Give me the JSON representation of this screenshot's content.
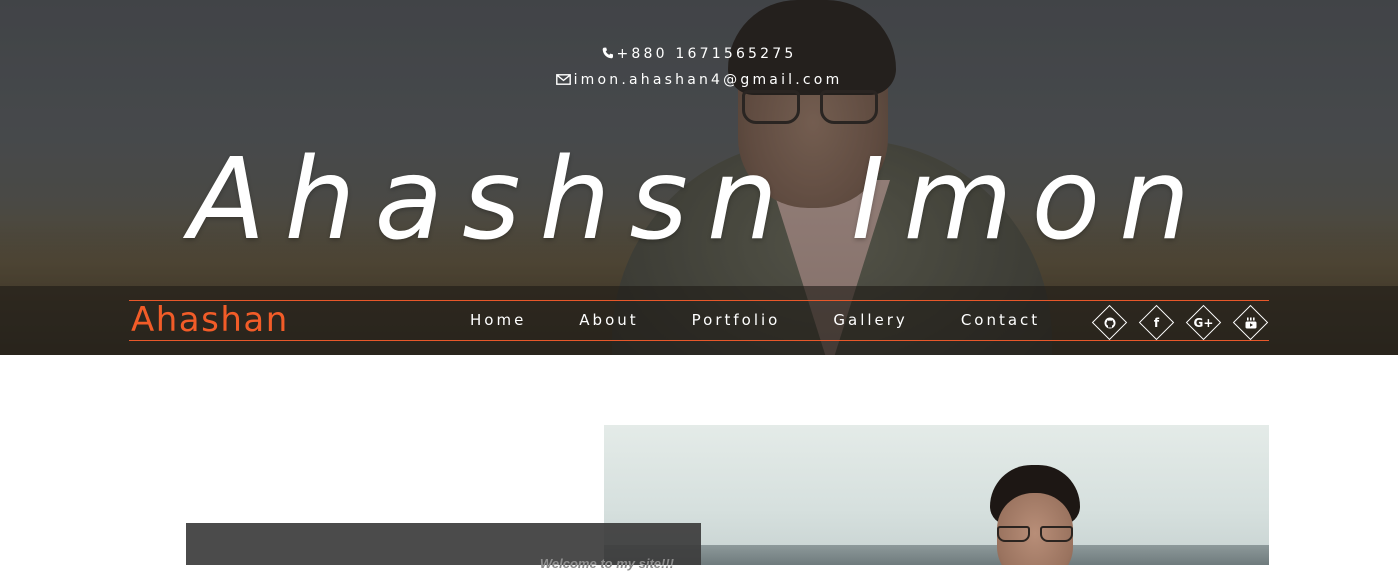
{
  "hero": {
    "phone_icon": "phone-icon",
    "phone": "+880 1671565275",
    "email_icon": "envelope-icon",
    "email": "imon.ahashan4@gmail.com",
    "title": "Ahashsn Imon"
  },
  "navbar": {
    "brand": "Ahashan",
    "accent_color": "#f25c28",
    "links": [
      {
        "label": "Home"
      },
      {
        "label": "About"
      },
      {
        "label": "Portfolio"
      },
      {
        "label": "Gallery"
      },
      {
        "label": "Contact"
      }
    ],
    "social": [
      {
        "icon": "github-icon",
        "glyph": "◉"
      },
      {
        "icon": "facebook-icon",
        "glyph": "f"
      },
      {
        "icon": "google-plus-icon",
        "glyph": "G+"
      },
      {
        "icon": "youtube-icon",
        "glyph": "▶"
      }
    ]
  },
  "about": {
    "welcome": "Welcome to my site!!!"
  }
}
